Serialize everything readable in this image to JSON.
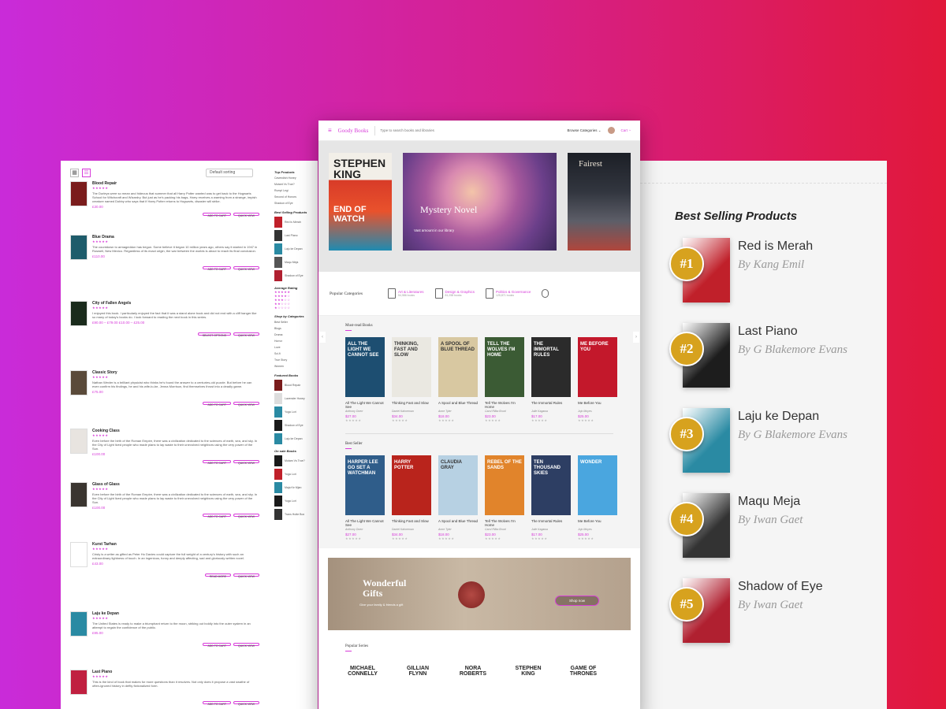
{
  "left": {
    "sort_label": "Default sorting",
    "items": [
      {
        "title": "Blood Repair",
        "desc": "The Durleys were so mean and hideous that summer that all Harry Potter wanted was to get back to the Hogwarts School for Witchcraft and Wizardry. But just as he's packing his bags, Harry receives a warning from a strange, impish creature named Dobby who says that if Harry Potter returns to Hogwarts, disaster will strike.",
        "price": "£30.00"
      },
      {
        "title": "Blue Drama",
        "desc": "The countdown to armageddon has begun. Some believe it began 10 million years ago, others say it started in 1947 in Roswell, New Mexico. Regardless of its exact origin, the war between the worlds is about to reach its final conclusion.",
        "price": "£110.00"
      },
      {
        "title": "City of Fallen Angels",
        "desc": "I enjoyed this book. I particularly enjoyed the fact that it was a stand alone book and did not end with a cliff hanger like so many of today's books do. I look forward to reading the next book in this series.",
        "price": "£90.00 – £79.00 £10.00 – £25.00"
      },
      {
        "title": "Classic Story",
        "desc": "Nathan Wexler is a brilliant physicist who thinks he's found the answer to a centuries-old puzzle. But before he can even confirm his findings, he and his wife-to-be, Jenna Morrison, find themselves thrust into a deadly game.",
        "price": "£75.00"
      },
      {
        "title": "Cooking Class",
        "desc": "Even before the birth of the Roman Empire, there was a civilization dedicated to the sciences of earth, sea, and sky. In the City of Light lived people who made plans to lay waste to their unevolved neighbors using the very power of the Sun.",
        "price": "£100.00"
      },
      {
        "title": "Glass of Glass",
        "desc": "Even before the birth of the Roman Empire, there was a civilization dedicated to the sciences of earth, sea, and sky. In the City of Light lived people who made plans to lay waste to their unevolved neighbors using the very power of the Sun.",
        "price": "£100.00"
      },
      {
        "title": "Kurst Tarhan",
        "desc": "Cristy is a writer as gifted as Peter Ho Davies could capture the full weight of a century's history with such an extraordinary lightness of touch. In an ingenious, funny and deeply affecting, sad and gloriously written novel.",
        "price": "£43.00"
      },
      {
        "title": "Laju ke Depan",
        "desc": "The United States is ready to make a triumphant return to the moon, striking out boldly into the outer system in an attempt to regain the confidence of the public.",
        "price": "£95.00"
      },
      {
        "title": "Last Piano",
        "desc": "This is the kind of book that makes for more questions than it resolves. Not only does it propose a vast swathe of often-ignored history in deftly fictionalized form.",
        "price": ""
      }
    ],
    "add_to_cart": "ADD TO CART",
    "quick_view": "QUICK VIEW",
    "select_options": "SELECT OPTIONS",
    "read_more": "READ MORE",
    "side": {
      "top_products_h": "Top Products",
      "top_products": [
        "Cavendish Honey",
        "Mutant Vs True?",
        "Rumpl Legi",
        "Second of Honors",
        "Shadow of Eye"
      ],
      "best_selling_h": "Best Selling Products",
      "best_selling": [
        "Red is Merah",
        "Last Piano",
        "Laju ke Depan",
        "Maqu Meja",
        "Shadow of Eye"
      ],
      "avg_rating_h": "Average Rating",
      "shop_by_h": "Shop by Categories",
      "shop_by": [
        "Best Seller",
        "Blogs",
        "Drama",
        "Horror",
        "Love",
        "Sci-fi",
        "True Story",
        "Women"
      ],
      "featured_h": "Featured Books",
      "featured": [
        "Blood Repair",
        "Lavender Honey",
        "Yoga Lori",
        "Shadow of Eye",
        "Laju ke Depan"
      ],
      "on_sale_h": "On sale Books",
      "on_sale": [
        "Mutam Vs True?",
        "Yoga Lori",
        "Maja Ke Mjan",
        "Yoga Lori",
        "Trans Hutte Box"
      ]
    }
  },
  "center": {
    "logo": "Goody Books",
    "search_placeholder": "Type to search books and libraries",
    "browse": "Browse Categories",
    "cart": "Cart",
    "hero": {
      "book1_author": "STEPHEN KING",
      "book1_title": "END OF WATCH",
      "book2_title": "Mystery Novel",
      "book2_sub": "Vast amount in our library",
      "book3_title": "Fairest"
    },
    "categories_h": "Popular Categories",
    "categories": [
      {
        "name": "Art & Literatures",
        "count": "54,986 books"
      },
      {
        "name": "Design & Graphics",
        "count": "81,258 books"
      },
      {
        "name": "Politics & Governance",
        "count": "125,871 books"
      }
    ],
    "must_read_h": "Must-read Books",
    "must_read": [
      {
        "cover": "ALL THE LIGHT WE CANNOT SEE",
        "title": "All The Light We Cannot See",
        "author": "Anthony Doerr",
        "price": "$27.00",
        "color": "#1d4e71"
      },
      {
        "cover": "THINKING, FAST AND SLOW",
        "title": "Thinking Fast and Slow",
        "author": "Daniel Kahneman",
        "price": "$34.00",
        "color": "#eae8e1"
      },
      {
        "cover": "A SPOOL OF BLUE THREAD",
        "title": "A Spool and Blue Thread",
        "author": "Anne Tyler",
        "price": "$18.00",
        "color": "#d8c8a1"
      },
      {
        "cover": "TELL THE WOLVES I'M HOME",
        "title": "Tell The Wolves I'm Home",
        "author": "Carol Rifka Brunt",
        "price": "$23.00",
        "color": "#3b5b34"
      },
      {
        "cover": "THE IMMORTAL RULES",
        "title": "The Immortal Rules",
        "author": "Julie Kagawa",
        "price": "$17.00",
        "color": "#2b2b2b"
      },
      {
        "cover": "ME BEFORE YOU",
        "title": "Me Before You",
        "author": "Jojo Moyes",
        "price": "$25.00",
        "color": "#c3182b"
      }
    ],
    "best_seller_h": "Best Seller",
    "best_seller": [
      {
        "cover": "HARPER LEE GO SET A WATCHMAN",
        "title": "All The Light We Cannot See",
        "author": "Anthony Doerr",
        "price": "$27.00",
        "color": "#2f5d8a"
      },
      {
        "cover": "HARRY POTTER",
        "title": "Thinking Fast and Slow",
        "author": "Daniel Kahneman",
        "price": "$34.00",
        "color": "#b9241c"
      },
      {
        "cover": "CLAUDIA GRAY",
        "title": "A Spool and Blue Thread",
        "author": "Anne Tyler",
        "price": "$18.00",
        "color": "#b7d1e3"
      },
      {
        "cover": "REBEL OF THE SANDS",
        "title": "Tell The Wolves I'm Home",
        "author": "Carol Rifka Brunt",
        "price": "$23.00",
        "color": "#e1842b"
      },
      {
        "cover": "TEN THOUSAND SKIES",
        "title": "The Immortal Rules",
        "author": "Julie Kagawa",
        "price": "$17.00",
        "color": "#2d3e63"
      },
      {
        "cover": "WONDER",
        "title": "Me Before You",
        "author": "Jojo Moyes",
        "price": "$25.00",
        "color": "#4aa6df"
      }
    ],
    "banner": {
      "title": "Wonderful Gifts",
      "sub": "Give your family & friends a gift",
      "button": "Shop now"
    },
    "series_h": "Popular Series",
    "series": [
      "MICHAEL CONNELLY",
      "GILLIAN FLYNN",
      "NORA ROBERTS",
      "STEPHEN KING",
      "GAME OF THRONES"
    ]
  },
  "right": {
    "title": "Best Selling Products",
    "items": [
      {
        "rank": "#1",
        "name": "Red is Merah",
        "author": "By Kang Emil"
      },
      {
        "rank": "#2",
        "name": "Last Piano",
        "author": "By G Blakemore Evans"
      },
      {
        "rank": "#3",
        "name": "Laju ke Depan",
        "author": "By G Blakemore Evans"
      },
      {
        "rank": "#4",
        "name": "Maqu Meja",
        "author": "By Iwan Gaet"
      },
      {
        "rank": "#5",
        "name": "Shadow of Eye",
        "author": "By Iwan Gaet"
      }
    ]
  }
}
